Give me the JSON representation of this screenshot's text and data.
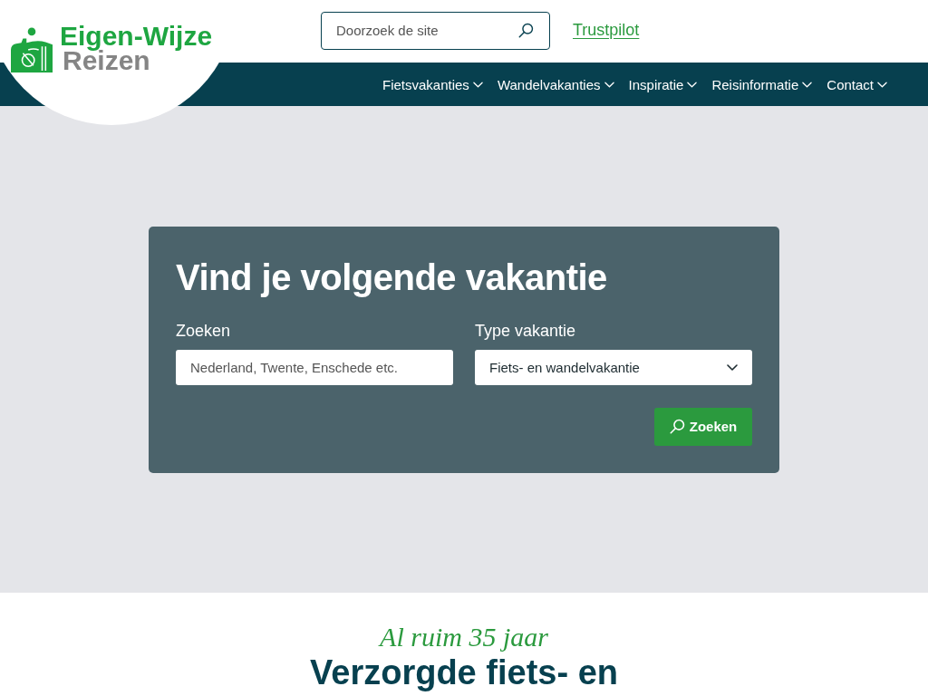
{
  "logo": {
    "line_1": "Eigen-Wijze",
    "line_2": "Reizen"
  },
  "header": {
    "search": {
      "placeholder": "Doorzoek de site"
    },
    "trustpilot_link": "Trustpilot"
  },
  "nav": {
    "items": [
      {
        "label": "Fietsvakanties",
        "has_menu": true
      },
      {
        "label": "Wandelvakanties",
        "has_menu": true
      },
      {
        "label": "Inspiratie",
        "has_menu": true
      },
      {
        "label": "Reisinformatie",
        "has_menu": true
      },
      {
        "label": "Contact",
        "has_menu": true
      }
    ]
  },
  "search_panel": {
    "title": "Vind je volgende vakantie",
    "fields": [
      {
        "kind": "text",
        "label": "Zoeken",
        "placeholder": "Nederland, Twente, Enschede etc."
      },
      {
        "kind": "select",
        "label": "Type vakantie",
        "value": "Fiets- en wandelvakantie"
      }
    ],
    "submit_button": "Zoeken"
  },
  "intro": {
    "tagline": "Al ruim 35 jaar",
    "heading": "Verzorgde fiets- en"
  }
}
